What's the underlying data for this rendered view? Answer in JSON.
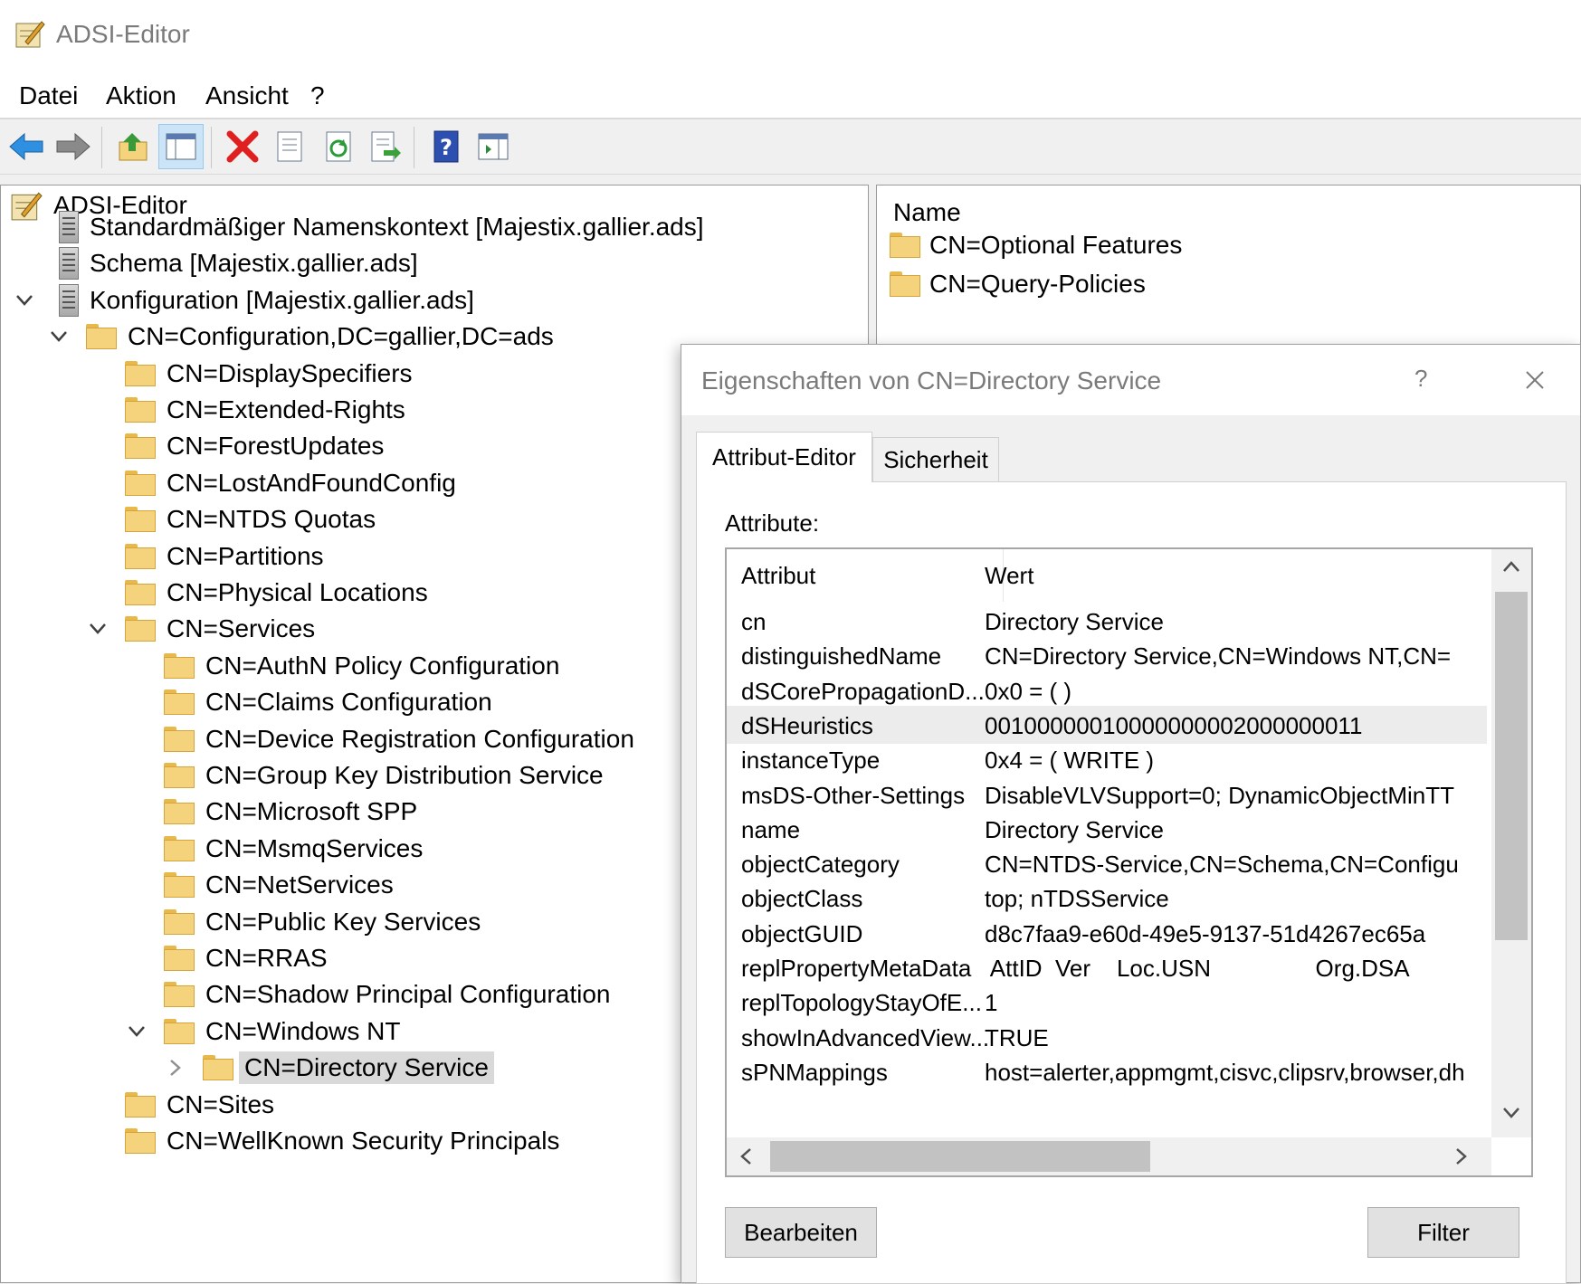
{
  "window": {
    "title": "ADSI-Editor"
  },
  "menu": [
    "Datei",
    "Aktion",
    "Ansicht",
    "?"
  ],
  "toolbar": {
    "buttons": [
      "back-arrow-icon",
      "forward-arrow-icon",
      "up-folder-icon",
      "show-hide-tree-icon",
      "delete-icon",
      "properties-icon",
      "refresh-icon",
      "export-list-icon",
      "help-icon",
      "show-hide-action-pane-icon"
    ]
  },
  "tree": {
    "root": "ADSI-Editor",
    "items": [
      "Standardmäßiger Namenskontext [Majestix.gallier.ads]",
      "Schema [Majestix.gallier.ads]",
      "Konfiguration [Majestix.gallier.ads]",
      "CN=Configuration,DC=gallier,DC=ads",
      "CN=DisplaySpecifiers",
      "CN=Extended-Rights",
      "CN=ForestUpdates",
      "CN=LostAndFoundConfig",
      "CN=NTDS Quotas",
      "CN=Partitions",
      "CN=Physical Locations",
      "CN=Services",
      "CN=AuthN Policy Configuration",
      "CN=Claims Configuration",
      "CN=Device Registration Configuration",
      "CN=Group Key Distribution Service",
      "CN=Microsoft SPP",
      "CN=MsmqServices",
      "CN=NetServices",
      "CN=Public Key Services",
      "CN=RRAS",
      "CN=Shadow Principal Configuration",
      "CN=Windows NT",
      "CN=Directory Service",
      "CN=Sites",
      "CN=WellKnown Security Principals"
    ]
  },
  "list": {
    "header": "Name",
    "items": [
      "CN=Optional Features",
      "CN=Query-Policies"
    ]
  },
  "dialog": {
    "title": "Eigenschaften von CN=Directory Service",
    "help": "?",
    "tabs": [
      "Attribut-Editor",
      "Sicherheit"
    ],
    "attributes_label": "Attribute:",
    "columns": [
      "Attribut",
      "Wert"
    ],
    "rows": [
      [
        "cn",
        "Directory Service"
      ],
      [
        "distinguishedName",
        "CN=Directory Service,CN=Windows NT,CN="
      ],
      [
        "dSCorePropagationD...",
        "0x0 = ( )"
      ],
      [
        "dSHeuristics",
        "00100000010000000002000000011"
      ],
      [
        "instanceType",
        "0x4 = ( WRITE )"
      ],
      [
        "msDS-Other-Settings",
        "DisableVLVSupport=0; DynamicObjectMinTT"
      ],
      [
        "name",
        "Directory Service"
      ],
      [
        "objectCategory",
        "CN=NTDS-Service,CN=Schema,CN=Configu"
      ],
      [
        "objectClass",
        "top; nTDSService"
      ],
      [
        "objectGUID",
        "d8c7faa9-e60d-49e5-9137-51d4267ec65a"
      ],
      [
        "replPropertyMetaData",
        " AttID  Ver    Loc.USN                Org.DSA"
      ],
      [
        "replTopologyStayOfE...",
        "1"
      ],
      [
        "showInAdvancedView...",
        "TRUE"
      ],
      [
        "sPNMappings",
        "host=alerter,appmgmt,cisvc,clipsrv,browser,dh"
      ]
    ],
    "selected_row": 3,
    "buttons": {
      "edit": "Bearbeiten",
      "filter": "Filter"
    }
  }
}
